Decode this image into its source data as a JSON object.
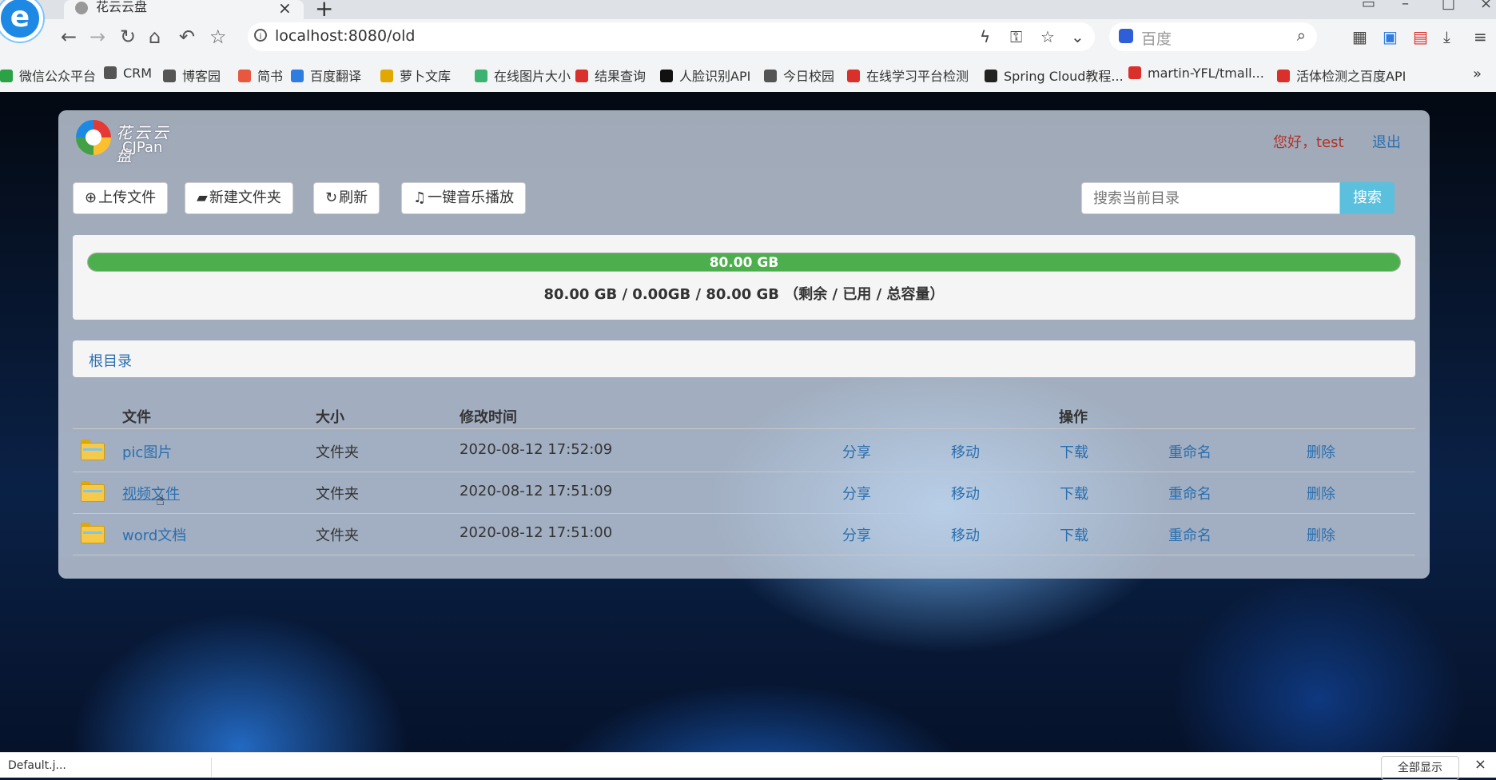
{
  "browser": {
    "tab_title": "花云云盘",
    "url": "localhost:8080/old",
    "search_placeholder": "百度",
    "bookmarks": [
      {
        "label": "微信公众平台",
        "color": "#2ba245"
      },
      {
        "label": "CRM",
        "color": "#555555"
      },
      {
        "label": "博客园",
        "color": "#555555"
      },
      {
        "label": "简书",
        "color": "#e9573f"
      },
      {
        "label": "百度翻译",
        "color": "#2f7de1"
      },
      {
        "label": "萝卜文库",
        "color": "#e0a800"
      },
      {
        "label": "在线图片大小",
        "color": "#3cb371"
      },
      {
        "label": "结果查询",
        "color": "#d9302c"
      },
      {
        "label": "人脸识别API",
        "color": "#111111"
      },
      {
        "label": "今日校园",
        "color": "#555555"
      },
      {
        "label": "在线学习平台检测",
        "color": "#d9302c"
      },
      {
        "label": "Spring Cloud教程...",
        "color": "#222222"
      },
      {
        "label": "martin-YFL/tmall...",
        "color": "#d9302c"
      },
      {
        "label": "活体检测之百度API",
        "color": "#d9302c"
      }
    ],
    "more": "»"
  },
  "header": {
    "logo_cn": "花云云盘",
    "logo_en": "CJPan",
    "greeting": "您好，test",
    "logout": "退出"
  },
  "toolbar": {
    "upload": "上传文件",
    "new_folder": "新建文件夹",
    "refresh": "刷新",
    "music": "一键音乐播放",
    "search_placeholder": "搜索当前目录",
    "search_button": "搜索"
  },
  "usage": {
    "bar_label": "80.00 GB",
    "remaining_fraction": 1.0,
    "summary": "80.00 GB / 0.00GB / 80.00 GB （剩余 / 已用 / 总容量）"
  },
  "breadcrumb": {
    "root": "根目录"
  },
  "table": {
    "headers": {
      "file": "文件",
      "size": "大小",
      "modified": "修改时间",
      "ops": "操作"
    },
    "rows": [
      {
        "name": "pic图片",
        "size": "文件夹",
        "modified": "2020-08-12 17:52:09"
      },
      {
        "name": "视频文件",
        "size": "文件夹",
        "modified": "2020-08-12 17:51:09"
      },
      {
        "name": "word文档",
        "size": "文件夹",
        "modified": "2020-08-12 17:51:00"
      }
    ],
    "actions": {
      "share": "分享",
      "move": "移动",
      "download": "下载",
      "rename": "重命名",
      "delete": "删除"
    }
  },
  "downloads": {
    "item": "Default.j...",
    "show_all": "全部显示"
  }
}
